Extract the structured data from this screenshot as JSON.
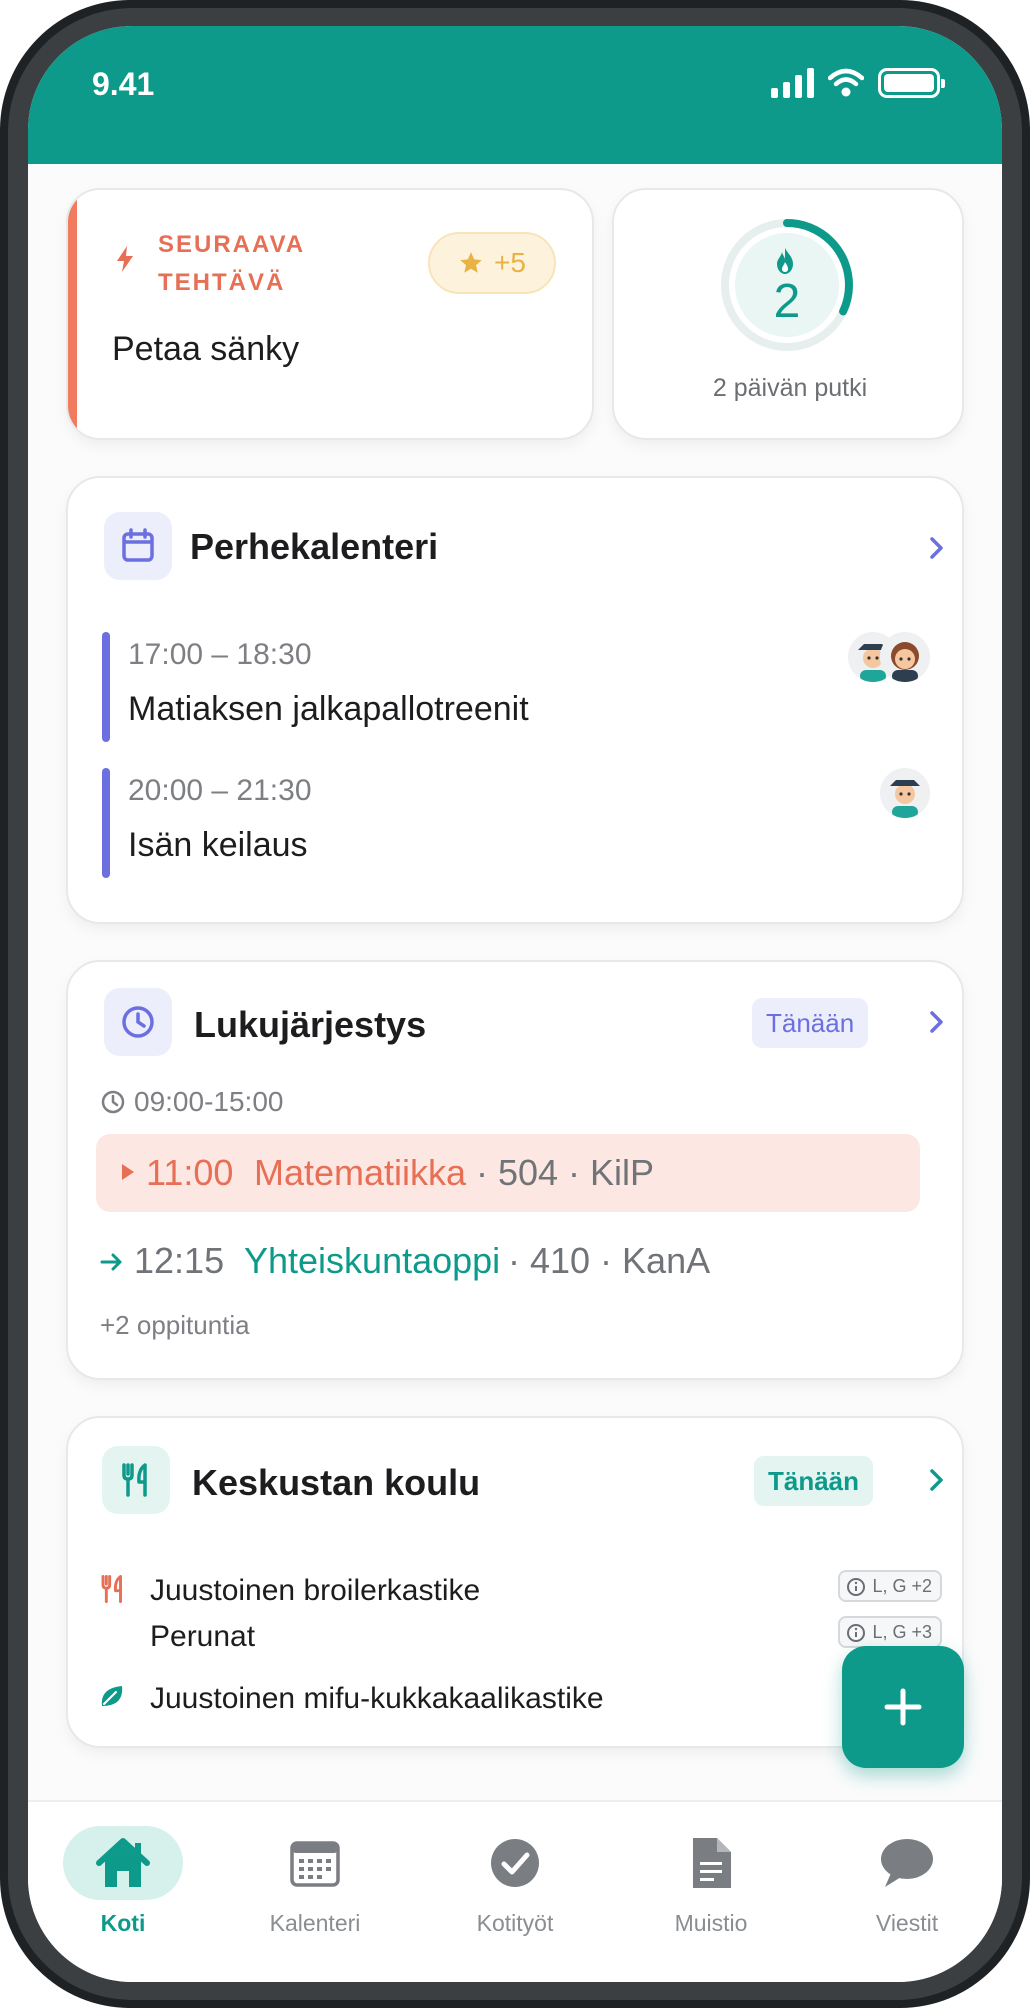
{
  "status_bar": {
    "time": "9.41"
  },
  "next_task": {
    "label": "SEURAAVA TEHTÄVÄ",
    "points": "+5",
    "title": "Petaa sänky"
  },
  "streak": {
    "count": "2",
    "label": "2 päivän putki",
    "progress": 0.32
  },
  "calendar": {
    "title": "Perhekalenteri",
    "events": [
      {
        "time": "17:00 – 18:30",
        "name": "Matiaksen jalkapallotreenit"
      },
      {
        "time": "20:00 – 21:30",
        "name": "Isän keilaus"
      }
    ]
  },
  "schedule": {
    "title": "Lukujärjestys",
    "today": "Tänään",
    "hours": "09:00-15:00",
    "current": {
      "time": "11:00",
      "subject": "Matematiikka",
      "rest": "· 504 · KilP"
    },
    "next": {
      "time": "12:15",
      "subject": "Yhteiskuntaoppi",
      "rest": "· 410 · KanA"
    },
    "more": "+2 oppituntia"
  },
  "menu": {
    "title": "Keskustan koulu",
    "today": "Tänään",
    "items": [
      {
        "name": "Juustoinen broilerkastike",
        "diet": "L, G +2"
      },
      {
        "name": "Perunat",
        "diet": "L, G +3"
      },
      {
        "name": "Juustoinen mifu-kukkakaalikastike",
        "diet": ""
      }
    ]
  },
  "tabs": [
    {
      "label": "Koti",
      "icon": "home-icon"
    },
    {
      "label": "Kalenteri",
      "icon": "calendar-icon"
    },
    {
      "label": "Kotityöt",
      "icon": "check-icon"
    },
    {
      "label": "Muistio",
      "icon": "document-icon"
    },
    {
      "label": "Viestit",
      "icon": "chat-icon"
    }
  ],
  "colors": {
    "primary": "#0e9a8a",
    "accent_orange": "#e76f55",
    "calendar_purple": "#6b6fe0",
    "gold": "#e8b245"
  }
}
